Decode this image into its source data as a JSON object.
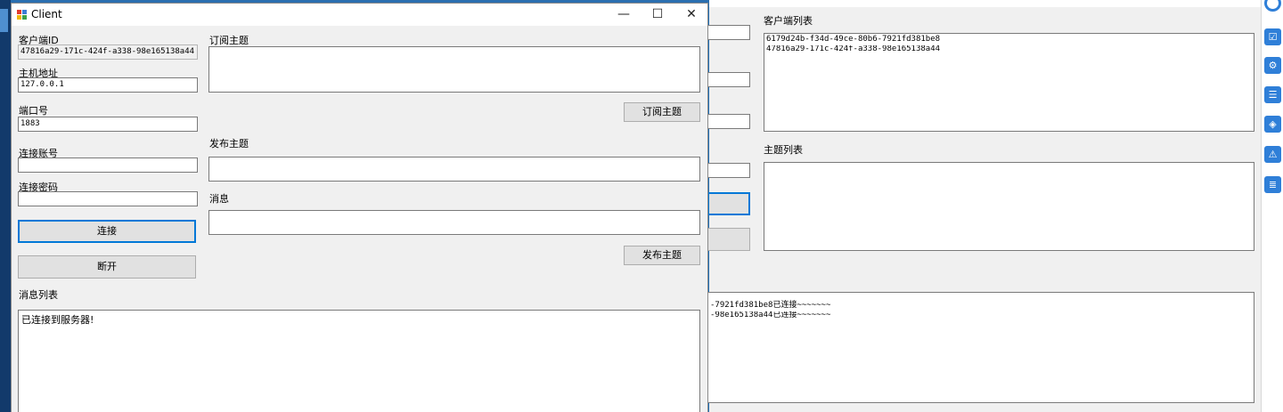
{
  "client": {
    "title": "Client",
    "labels": {
      "client_id": "客户端ID",
      "host": "主机地址",
      "port": "端口号",
      "account": "连接账号",
      "password": "连接密码",
      "subscribe_topic": "订阅主题",
      "publish_topic": "发布主题",
      "message": "消息",
      "message_list": "消息列表"
    },
    "values": {
      "client_id": "47816a29-171c-424f-a338-98e165138a44",
      "host": "127.0.0.1",
      "port": "1883",
      "account": "",
      "password": "",
      "publish_topic": "",
      "message": ""
    },
    "buttons": {
      "connect": "连接",
      "disconnect": "断开",
      "subscribe": "订阅主题",
      "publish": "发布主题"
    },
    "message_list": [
      "已连接到服务器!"
    ]
  },
  "server": {
    "labels": {
      "client_list": "客户端列表",
      "topic_list": "主题列表"
    },
    "client_list": [
      "6179d24b-f34d-49ce-80b6-7921fd381be8",
      "47816a29-171c-424f-a338-98e165138a44"
    ],
    "log": [
      "-7921fd381be8已连接~~~~~~~",
      "-98e165138a44已连接~~~~~~~"
    ]
  },
  "dock": {
    "icons": [
      "gear-icon",
      "checklist-icon",
      "settings-icon",
      "list-icon",
      "layers-icon",
      "warning-icon",
      "doc-settings-icon"
    ]
  },
  "colors": {
    "accent": "#0078d7",
    "desktop": "#1e6fb8",
    "window_bg": "#f0f0f0"
  }
}
